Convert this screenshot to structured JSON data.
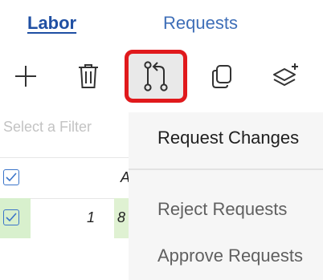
{
  "tabs": {
    "labor": "Labor",
    "requests": "Requests"
  },
  "toolbar": {
    "icons": [
      "plus-icon",
      "trash-icon",
      "request-changes-icon",
      "copy-icon",
      "layers-add-icon"
    ],
    "highlight_color": "#e0191c"
  },
  "grid": {
    "filter_placeholder": "Select a Filter",
    "header_col_a": "A",
    "row": {
      "value_1": "1",
      "value_2": "8"
    }
  },
  "menu": {
    "items": [
      "Request Changes",
      "Reject Requests",
      "Approve Requests"
    ]
  },
  "colors": {
    "accent_blue": "#1f4fa3",
    "row_green": "#d8f0cd"
  }
}
